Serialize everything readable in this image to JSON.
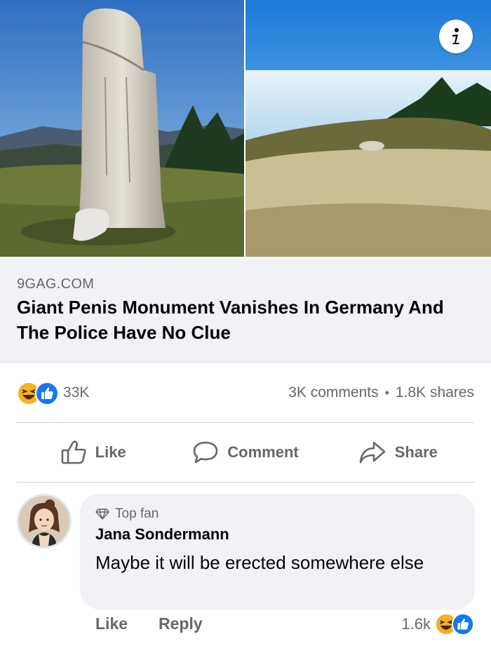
{
  "post": {
    "images": [
      "wooden-monument-photo",
      "empty-hilltop-photo"
    ],
    "info_icon": "info-icon"
  },
  "link_preview": {
    "domain": "9GAG.COM",
    "headline": "Giant Penis Monument Vanishes In Germany And The Police Have No Clue"
  },
  "stats": {
    "reaction_icons": [
      "haha-icon",
      "like-icon"
    ],
    "reaction_count": "33K",
    "comments": "3K comments",
    "separator": "•",
    "shares": "1.8K shares"
  },
  "actions": {
    "like_label": "Like",
    "comment_label": "Comment",
    "share_label": "Share"
  },
  "comment": {
    "badge": "Top fan",
    "author": "Jana Sondermann",
    "text": "Maybe it will be erected somewhere else",
    "like_label": "Like",
    "reply_label": "Reply",
    "reaction_count": "1.6k"
  },
  "colors": {
    "like_blue": "#1877f2",
    "haha_yellow": "#f7b125",
    "secondary_text": "#65676b",
    "bubble_bg": "#f0f2f5"
  }
}
